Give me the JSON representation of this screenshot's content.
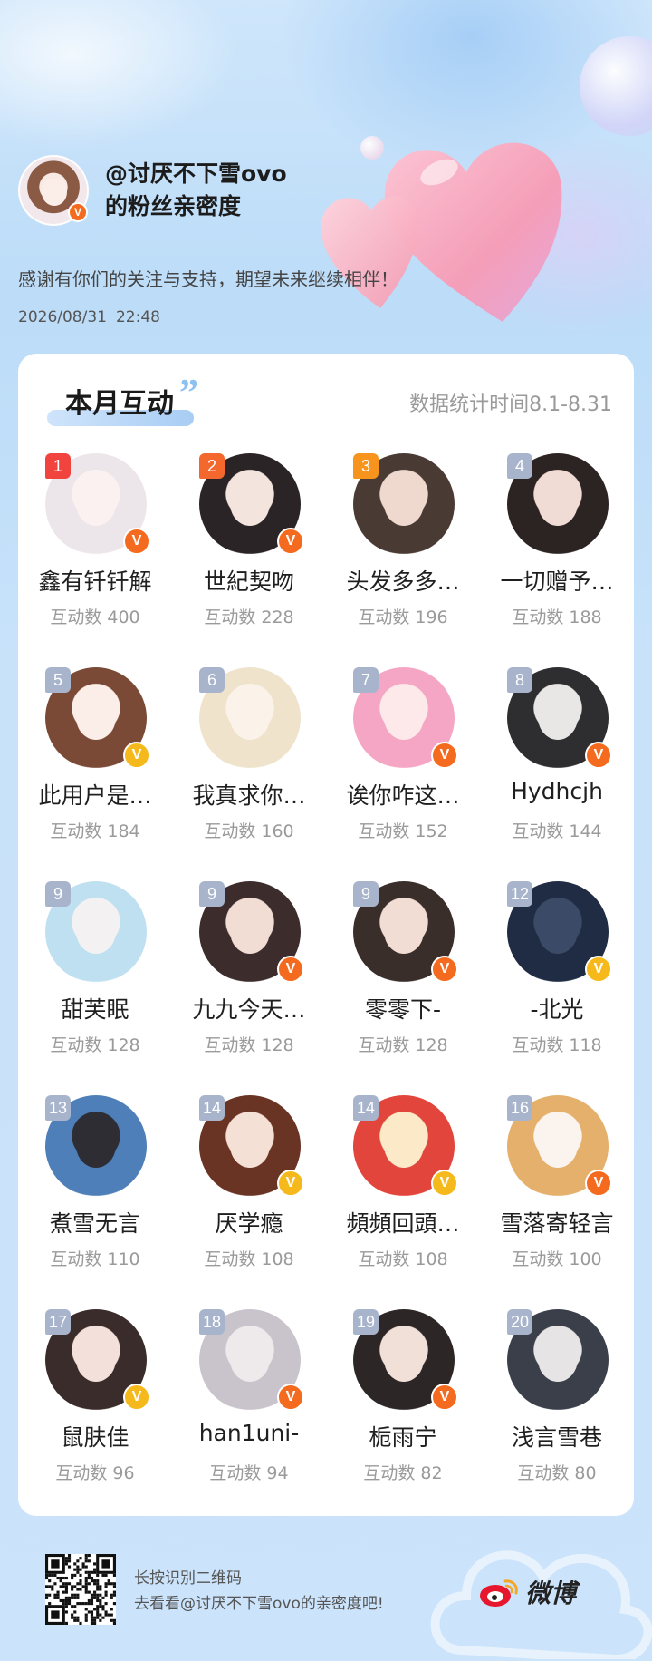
{
  "profile": {
    "handle": "@讨厌不下雪ovo",
    "subtitle": "的粉丝亲密度",
    "thanks": "感谢有你们的关注与支持，期望未来继续相伴！",
    "date": "2026/08/31",
    "time": "22:48"
  },
  "section": {
    "title": "本月互动",
    "stat_period": "数据统计时间8.1-8.31",
    "count_label": "互动数"
  },
  "colors": {
    "rank_top1": "#f2443f",
    "rank_top2": "#f4672d",
    "rank_top3": "#f7941d",
    "rank_other": "#a7b4cc",
    "badge_orange": "#f46a1e",
    "badge_gold": "#f5b91b"
  },
  "fans": [
    {
      "rank": "1",
      "name": "鑫有钎钎解",
      "count": "400",
      "badge": "orange",
      "hair": "#ece6ea",
      "skin": "#fbf1f0"
    },
    {
      "rank": "2",
      "name": "世紀契吻",
      "count": "228",
      "badge": "orange",
      "hair": "#2a2426",
      "skin": "#f4e4de"
    },
    {
      "rank": "3",
      "name": "头发多多…",
      "count": "196",
      "badge": "none",
      "hair": "#4a3a34",
      "skin": "#efd9cf"
    },
    {
      "rank": "4",
      "name": "一切赠予…",
      "count": "188",
      "badge": "none",
      "hair": "#2b2422",
      "skin": "#f0dcd4"
    },
    {
      "rank": "5",
      "name": "此用户是…",
      "count": "184",
      "badge": "gold",
      "hair": "#7a4a36",
      "skin": "#fbeee8"
    },
    {
      "rank": "6",
      "name": "我真求你…",
      "count": "160",
      "badge": "none",
      "hair": "#efe3cc",
      "skin": "#fbf2ea"
    },
    {
      "rank": "7",
      "name": "诶你咋这…",
      "count": "152",
      "badge": "orange",
      "hair": "#f5a6c4",
      "skin": "#fde9ea"
    },
    {
      "rank": "8",
      "name": "Hydhcjh",
      "count": "144",
      "badge": "orange",
      "hair": "#2e2e30",
      "skin": "#e9e6e6"
    },
    {
      "rank": "9",
      "name": "甜芙眠",
      "count": "128",
      "badge": "none",
      "hair": "#bfe0f0",
      "skin": "#f4f1f2"
    },
    {
      "rank": "9",
      "name": "九九今天…",
      "count": "128",
      "badge": "orange",
      "hair": "#3c2c2c",
      "skin": "#f2ddd4"
    },
    {
      "rank": "9",
      "name": "零零下-",
      "count": "128",
      "badge": "orange",
      "hair": "#3a2e2a",
      "skin": "#f1ddd3"
    },
    {
      "rank": "12",
      "name": "-北光",
      "count": "118",
      "badge": "gold",
      "hair": "#1f2c44",
      "skin": "#3b4a66"
    },
    {
      "rank": "13",
      "name": "煮雪无言",
      "count": "110",
      "badge": "none",
      "hair": "#4f7fb8",
      "skin": "#2d2d33"
    },
    {
      "rank": "14",
      "name": "厌学瘾",
      "count": "108",
      "badge": "gold",
      "hair": "#6a3424",
      "skin": "#f5e0d6"
    },
    {
      "rank": "14",
      "name": "頻頻回頭…",
      "count": "108",
      "badge": "gold",
      "hair": "#e2453b",
      "skin": "#fbe9c8"
    },
    {
      "rank": "16",
      "name": "雪落寄轻言",
      "count": "100",
      "badge": "orange",
      "hair": "#e4b06c",
      "skin": "#fbf4ee"
    },
    {
      "rank": "17",
      "name": "鼠肤佳",
      "count": "96",
      "badge": "gold",
      "hair": "#3a2c2a",
      "skin": "#f3e0da"
    },
    {
      "rank": "18",
      "name": "han1uni-",
      "count": "94",
      "badge": "orange",
      "hair": "#c9c4cc",
      "skin": "#eee9ea"
    },
    {
      "rank": "19",
      "name": "栀雨宁",
      "count": "82",
      "badge": "orange",
      "hair": "#2c2626",
      "skin": "#f1e0d8"
    },
    {
      "rank": "20",
      "name": "浅言雪巷",
      "count": "80",
      "badge": "none",
      "hair": "#3a3f4a",
      "skin": "#e7e4e6"
    }
  ],
  "footer": {
    "scan_hint": "长按识别二维码",
    "cta": "去看看@讨厌不下雪ovo的亲密度吧!",
    "brand": "微博",
    "qr_icon": "qr-code-icon",
    "brand_icon": "weibo-logo-icon"
  }
}
